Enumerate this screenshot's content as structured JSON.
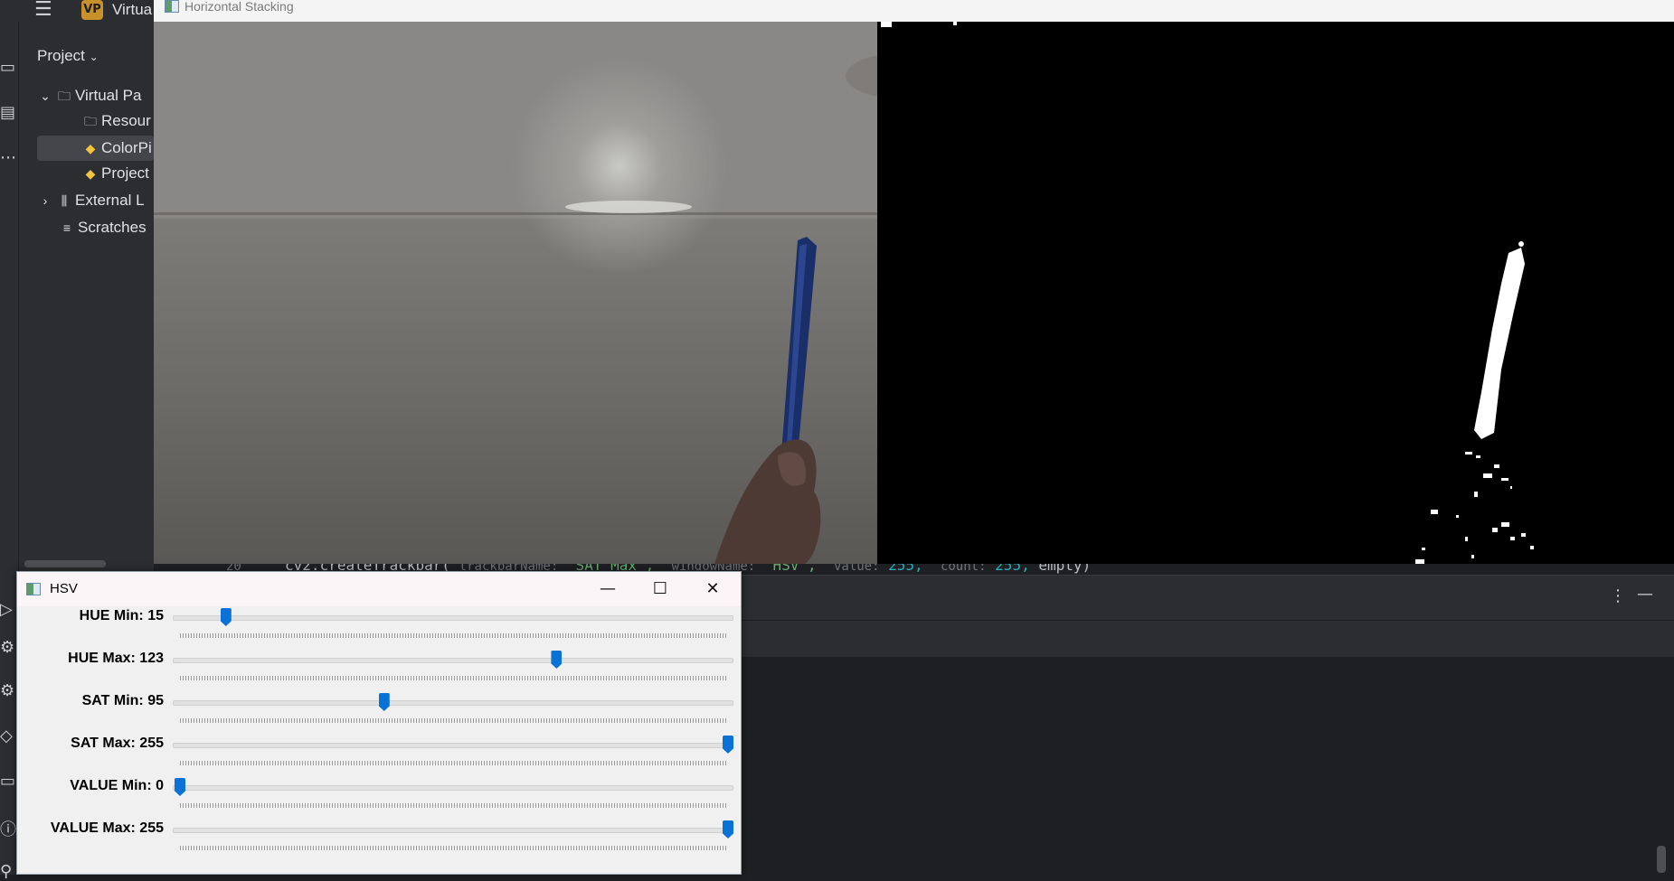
{
  "ide": {
    "badge": "VP",
    "project_name": "Virtua",
    "project_panel_title": "Project",
    "tree": [
      {
        "label": "Virtual Pa",
        "icon": "folder-icon",
        "expanded": true
      },
      {
        "label": "Resour",
        "icon": "folder-icon"
      },
      {
        "label": "ColorPi",
        "icon": "python-file-icon",
        "selected": true
      },
      {
        "label": "Project",
        "icon": "python-file-icon"
      },
      {
        "label": "External L",
        "icon": "library-icon",
        "expanded": false
      },
      {
        "label": "Scratches",
        "icon": "scratches-icon"
      }
    ],
    "code_line": {
      "number": "20",
      "fn": "cv2.createTrackbar(",
      "hint_trackbar": "trackbarName:",
      "str_trackbar": "\"SAT Max\",",
      "hint_window": "windowName:",
      "str_window": "\"HSV\",",
      "hint_value": "value:",
      "num_value": "255,",
      "hint_count": "count:",
      "num_count": "255,",
      "tail": "empty)"
    }
  },
  "stack_window": {
    "title": "Horizontal Stacking"
  },
  "hsv_window": {
    "title": "HSV",
    "minimize": "—",
    "maximize": "☐",
    "close": "✕",
    "trackbars": [
      {
        "label": "HUE Min: 15",
        "value": 15,
        "max": 179
      },
      {
        "label": "HUE Max: 123",
        "value": 123,
        "max": 179
      },
      {
        "label": "SAT Min: 95",
        "value": 95,
        "max": 255
      },
      {
        "label": "SAT Max: 255",
        "value": 255,
        "max": 255
      },
      {
        "label": "VALUE Min: 0",
        "value": 0,
        "max": 255
      },
      {
        "label": "VALUE Max: 255",
        "value": 255,
        "max": 255
      }
    ]
  }
}
